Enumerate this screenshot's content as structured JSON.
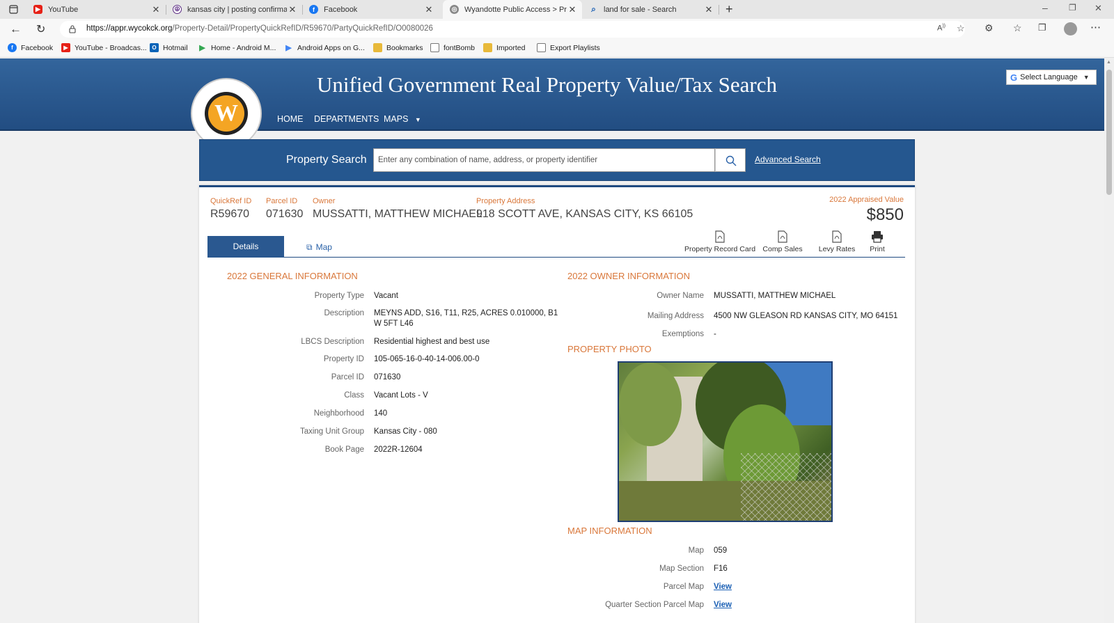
{
  "browser": {
    "tabs": [
      {
        "label": "YouTube",
        "icon": "youtube-icon",
        "color": "#e62117"
      },
      {
        "label": "kansas city | posting confirmation",
        "icon": "peace-icon",
        "color": "#5a2a82"
      },
      {
        "label": "Facebook",
        "icon": "facebook-icon",
        "color": "#1877f2"
      },
      {
        "label": "Wyandotte Public Access > Prope",
        "icon": "globe-icon",
        "color": "#666666"
      },
      {
        "label": "land for sale - Search",
        "icon": "search-icon",
        "color": "#1a5fb4"
      }
    ],
    "url_domain": "https://appr.wycokck.org",
    "url_path": "/Property-Detail/PropertyQuickRefID/R59670/PartyQuickRefID/O0080026",
    "bookmarks": [
      {
        "label": "Facebook",
        "color": "#1877f2"
      },
      {
        "label": "YouTube - Broadcas...",
        "color": "#e62117"
      },
      {
        "label": "Hotmail",
        "color": "#0a64b8"
      },
      {
        "label": "Home - Android M...",
        "color": "#34a853"
      },
      {
        "label": "Android Apps on G...",
        "color": "#4285f4"
      },
      {
        "label": "Bookmarks",
        "color": "#e8b93a"
      },
      {
        "label": "fontBomb",
        "color": "#777777"
      },
      {
        "label": "Imported",
        "color": "#e8b93a"
      },
      {
        "label": "Export Playlists",
        "color": "#777777"
      }
    ]
  },
  "header": {
    "title": "Unified Government Real Property Value/Tax Search",
    "nav": [
      "HOME",
      "DEPARTMENTS",
      "MAPS"
    ],
    "language": "Select Language"
  },
  "search": {
    "label": "Property Search",
    "placeholder": "Enter any combination of name, address, or property identifier",
    "advanced": "Advanced Search"
  },
  "summary": {
    "quickref_label": "QuickRef ID",
    "quickref": "R59670",
    "parcel_label": "Parcel ID",
    "parcel": "071630",
    "owner_label": "Owner",
    "owner": "MUSSATTI, MATTHEW MICHAEL",
    "address_label": "Property Address",
    "address": "918 SCOTT AVE, KANSAS CITY, KS 66105",
    "appraised_label": "2022 Appraised Value",
    "appraised": "$850"
  },
  "tabs": {
    "details": "Details",
    "map": "Map"
  },
  "tools": [
    "Property Record Card",
    "Comp Sales",
    "Levy Rates",
    "Print"
  ],
  "general": {
    "heading": "2022 GENERAL INFORMATION",
    "rows": [
      {
        "label": "Property Type",
        "value": "Vacant"
      },
      {
        "label": "Description",
        "value": "MEYNS ADD, S16, T11, R25, ACRES 0.010000, B1",
        "value2": "W 5FT L46"
      },
      {
        "label": "LBCS Description",
        "value": "Residential highest and best use"
      },
      {
        "label": "Property ID",
        "value": "105-065-16-0-40-14-006.00-0"
      },
      {
        "label": "Parcel ID",
        "value": "071630"
      },
      {
        "label": "Class",
        "value": "Vacant Lots - V"
      },
      {
        "label": "Neighborhood",
        "value": "140"
      },
      {
        "label": "Taxing Unit Group",
        "value": "Kansas City - 080"
      },
      {
        "label": "Book Page",
        "value": "2022R-12604"
      }
    ]
  },
  "owner": {
    "heading": "2022 OWNER INFORMATION",
    "rows": [
      {
        "label": "Owner Name",
        "value": "MUSSATTI, MATTHEW MICHAEL"
      },
      {
        "label": "Mailing Address",
        "value": "4500 NW GLEASON RD KANSAS CITY, MO 64151"
      },
      {
        "label": "Exemptions",
        "value": "-"
      }
    ]
  },
  "photo": {
    "heading": "PROPERTY PHOTO"
  },
  "map_info": {
    "heading": "MAP INFORMATION",
    "rows": [
      {
        "label": "Map",
        "value": "059"
      },
      {
        "label": "Map Section",
        "value": "F16"
      },
      {
        "label": "Parcel Map",
        "link": "View"
      },
      {
        "label": "Quarter Section Parcel Map",
        "link": "View"
      }
    ]
  }
}
